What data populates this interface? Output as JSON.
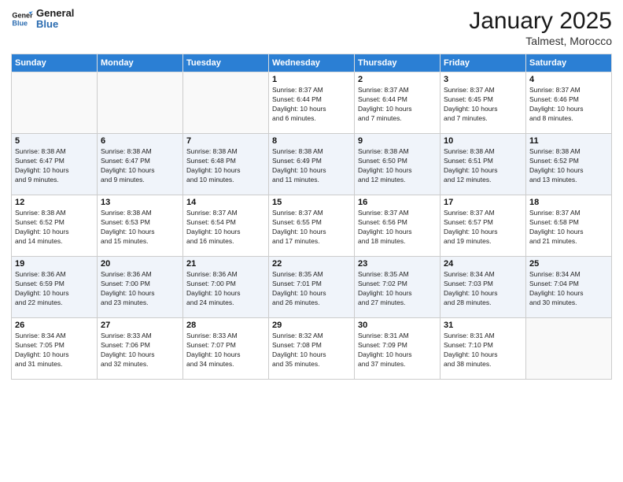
{
  "header": {
    "logo_general": "General",
    "logo_blue": "Blue",
    "month_title": "January 2025",
    "subtitle": "Talmest, Morocco"
  },
  "weekdays": [
    "Sunday",
    "Monday",
    "Tuesday",
    "Wednesday",
    "Thursday",
    "Friday",
    "Saturday"
  ],
  "weeks": [
    [
      {
        "day": "",
        "info": ""
      },
      {
        "day": "",
        "info": ""
      },
      {
        "day": "",
        "info": ""
      },
      {
        "day": "1",
        "info": "Sunrise: 8:37 AM\nSunset: 6:44 PM\nDaylight: 10 hours\nand 6 minutes."
      },
      {
        "day": "2",
        "info": "Sunrise: 8:37 AM\nSunset: 6:44 PM\nDaylight: 10 hours\nand 7 minutes."
      },
      {
        "day": "3",
        "info": "Sunrise: 8:37 AM\nSunset: 6:45 PM\nDaylight: 10 hours\nand 7 minutes."
      },
      {
        "day": "4",
        "info": "Sunrise: 8:37 AM\nSunset: 6:46 PM\nDaylight: 10 hours\nand 8 minutes."
      }
    ],
    [
      {
        "day": "5",
        "info": "Sunrise: 8:38 AM\nSunset: 6:47 PM\nDaylight: 10 hours\nand 9 minutes."
      },
      {
        "day": "6",
        "info": "Sunrise: 8:38 AM\nSunset: 6:47 PM\nDaylight: 10 hours\nand 9 minutes."
      },
      {
        "day": "7",
        "info": "Sunrise: 8:38 AM\nSunset: 6:48 PM\nDaylight: 10 hours\nand 10 minutes."
      },
      {
        "day": "8",
        "info": "Sunrise: 8:38 AM\nSunset: 6:49 PM\nDaylight: 10 hours\nand 11 minutes."
      },
      {
        "day": "9",
        "info": "Sunrise: 8:38 AM\nSunset: 6:50 PM\nDaylight: 10 hours\nand 12 minutes."
      },
      {
        "day": "10",
        "info": "Sunrise: 8:38 AM\nSunset: 6:51 PM\nDaylight: 10 hours\nand 12 minutes."
      },
      {
        "day": "11",
        "info": "Sunrise: 8:38 AM\nSunset: 6:52 PM\nDaylight: 10 hours\nand 13 minutes."
      }
    ],
    [
      {
        "day": "12",
        "info": "Sunrise: 8:38 AM\nSunset: 6:52 PM\nDaylight: 10 hours\nand 14 minutes."
      },
      {
        "day": "13",
        "info": "Sunrise: 8:38 AM\nSunset: 6:53 PM\nDaylight: 10 hours\nand 15 minutes."
      },
      {
        "day": "14",
        "info": "Sunrise: 8:37 AM\nSunset: 6:54 PM\nDaylight: 10 hours\nand 16 minutes."
      },
      {
        "day": "15",
        "info": "Sunrise: 8:37 AM\nSunset: 6:55 PM\nDaylight: 10 hours\nand 17 minutes."
      },
      {
        "day": "16",
        "info": "Sunrise: 8:37 AM\nSunset: 6:56 PM\nDaylight: 10 hours\nand 18 minutes."
      },
      {
        "day": "17",
        "info": "Sunrise: 8:37 AM\nSunset: 6:57 PM\nDaylight: 10 hours\nand 19 minutes."
      },
      {
        "day": "18",
        "info": "Sunrise: 8:37 AM\nSunset: 6:58 PM\nDaylight: 10 hours\nand 21 minutes."
      }
    ],
    [
      {
        "day": "19",
        "info": "Sunrise: 8:36 AM\nSunset: 6:59 PM\nDaylight: 10 hours\nand 22 minutes."
      },
      {
        "day": "20",
        "info": "Sunrise: 8:36 AM\nSunset: 7:00 PM\nDaylight: 10 hours\nand 23 minutes."
      },
      {
        "day": "21",
        "info": "Sunrise: 8:36 AM\nSunset: 7:00 PM\nDaylight: 10 hours\nand 24 minutes."
      },
      {
        "day": "22",
        "info": "Sunrise: 8:35 AM\nSunset: 7:01 PM\nDaylight: 10 hours\nand 26 minutes."
      },
      {
        "day": "23",
        "info": "Sunrise: 8:35 AM\nSunset: 7:02 PM\nDaylight: 10 hours\nand 27 minutes."
      },
      {
        "day": "24",
        "info": "Sunrise: 8:34 AM\nSunset: 7:03 PM\nDaylight: 10 hours\nand 28 minutes."
      },
      {
        "day": "25",
        "info": "Sunrise: 8:34 AM\nSunset: 7:04 PM\nDaylight: 10 hours\nand 30 minutes."
      }
    ],
    [
      {
        "day": "26",
        "info": "Sunrise: 8:34 AM\nSunset: 7:05 PM\nDaylight: 10 hours\nand 31 minutes."
      },
      {
        "day": "27",
        "info": "Sunrise: 8:33 AM\nSunset: 7:06 PM\nDaylight: 10 hours\nand 32 minutes."
      },
      {
        "day": "28",
        "info": "Sunrise: 8:33 AM\nSunset: 7:07 PM\nDaylight: 10 hours\nand 34 minutes."
      },
      {
        "day": "29",
        "info": "Sunrise: 8:32 AM\nSunset: 7:08 PM\nDaylight: 10 hours\nand 35 minutes."
      },
      {
        "day": "30",
        "info": "Sunrise: 8:31 AM\nSunset: 7:09 PM\nDaylight: 10 hours\nand 37 minutes."
      },
      {
        "day": "31",
        "info": "Sunrise: 8:31 AM\nSunset: 7:10 PM\nDaylight: 10 hours\nand 38 minutes."
      },
      {
        "day": "",
        "info": ""
      }
    ]
  ]
}
